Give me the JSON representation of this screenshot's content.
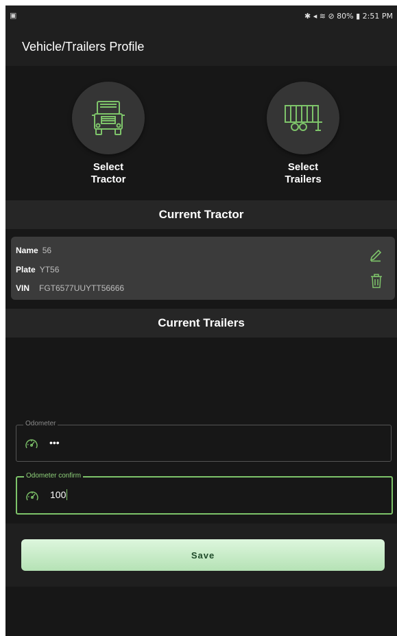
{
  "status_bar": {
    "left_icon": "image-notification-icon",
    "right_text": "✱ ◂ ≋ ⊘ 80% ▮ 2:51 PM"
  },
  "app_bar": {
    "title": "Vehicle/Trailers Profile"
  },
  "selectors": {
    "tractor_label": "Select\nTractor",
    "trailers_label": "Select\nTrailers",
    "tractor_icon": "truck-icon",
    "trailers_icon": "trailer-icon"
  },
  "current_tractor": {
    "heading": "Current Tractor",
    "name_key": "Name",
    "name_value": "56",
    "plate_key": "Plate",
    "plate_value": "YT56",
    "vin_key": "VIN",
    "vin_value": "FGT6577UUYTT56666",
    "edit_icon": "pencil-icon",
    "delete_icon": "trash-icon"
  },
  "current_trailers": {
    "heading": "Current Trailers"
  },
  "odometer": {
    "legend": "Odometer",
    "value": "•••"
  },
  "odometer_confirm": {
    "legend": "Odometer confirm",
    "value": "100"
  },
  "save": {
    "label": "Save"
  },
  "colors": {
    "accent_green": "#7ec46a",
    "save_button": "#c8edc8",
    "background": "#171717"
  }
}
